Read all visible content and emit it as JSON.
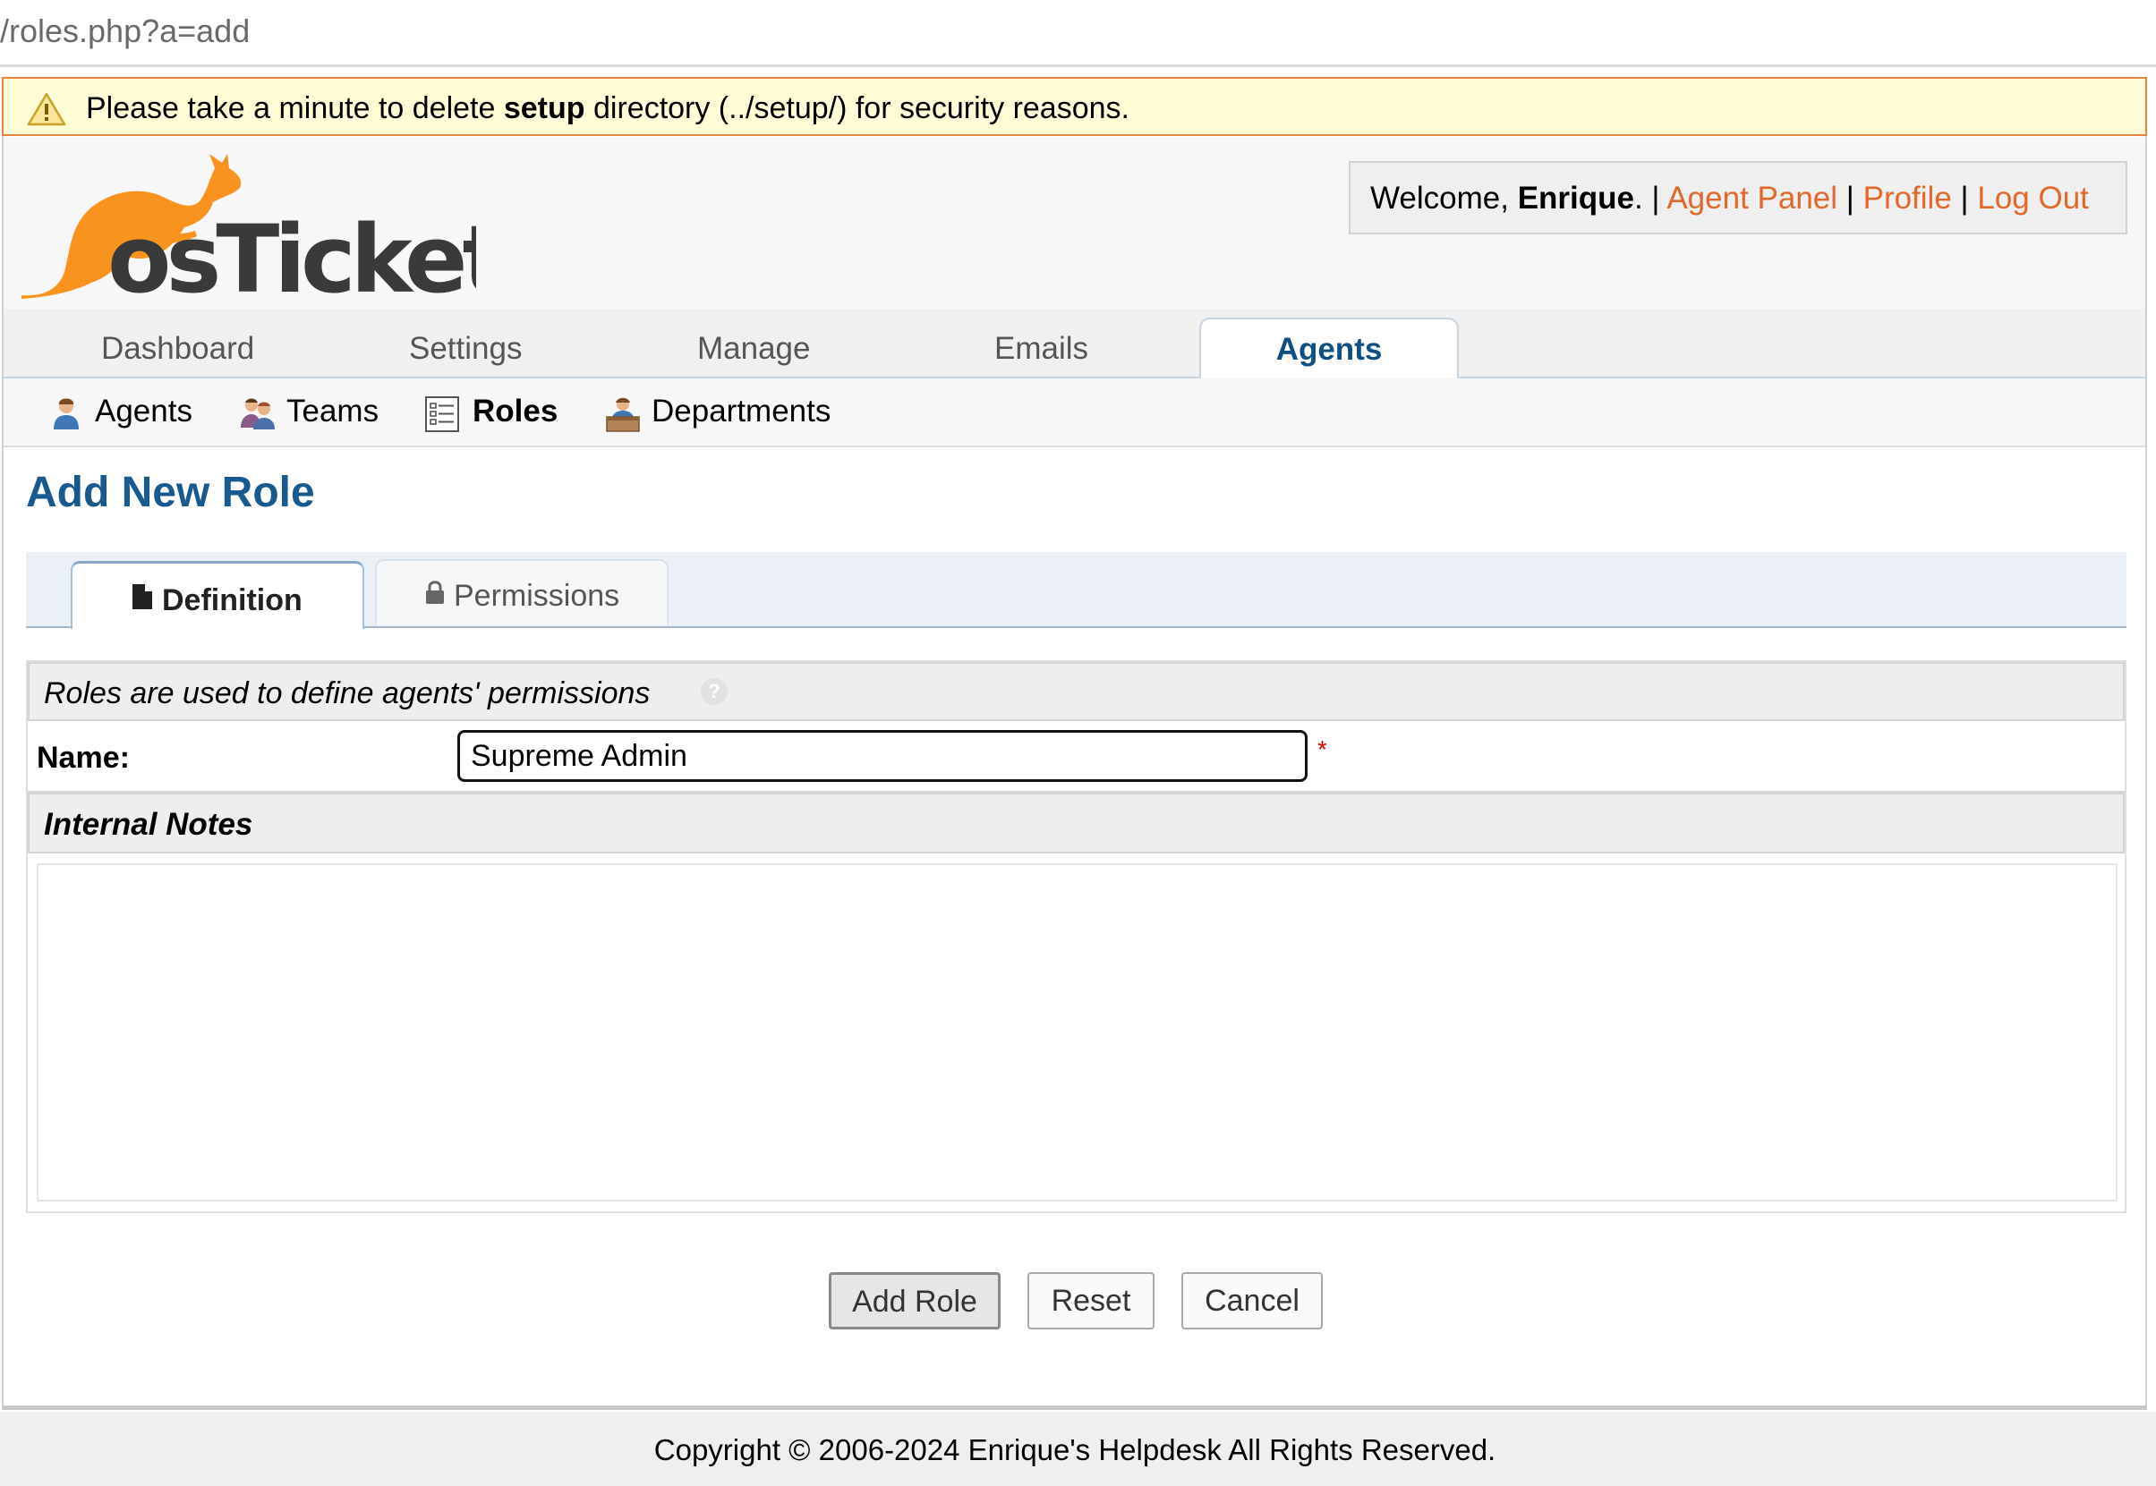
{
  "browser": {
    "url": "/roles.php?a=add"
  },
  "warning": {
    "pre": "Please take a minute to delete ",
    "bold": "setup",
    "post": " directory (../setup/) for security reasons."
  },
  "logo": {
    "text": "osTicket"
  },
  "welcome": {
    "prefix": "Welcome, ",
    "user": "Enrique",
    "suffix": ". | ",
    "agent_panel": "Agent Panel",
    "sep": " | ",
    "profile": "Profile",
    "logout": "Log Out"
  },
  "nav": {
    "items": [
      "Dashboard",
      "Settings",
      "Manage",
      "Emails",
      "Agents"
    ],
    "active": "Agents"
  },
  "subnav": {
    "items": [
      "Agents",
      "Teams",
      "Roles",
      "Departments"
    ],
    "active": "Roles"
  },
  "page": {
    "title": "Add New Role"
  },
  "tabs": {
    "definition": "Definition",
    "permissions": "Permissions"
  },
  "form": {
    "roles_header": "Roles are used to define agents' permissions",
    "help_icon": "?",
    "name_label": "Name:",
    "name_value": "Supreme Admin",
    "required_marker": "*",
    "notes_header": "Internal Notes",
    "notes_value": ""
  },
  "buttons": {
    "add": "Add Role",
    "reset": "Reset",
    "cancel": "Cancel"
  },
  "footer": {
    "copyright": "Copyright © 2006-2024 Enrique's Helpdesk All Rights Reserved."
  },
  "colors": {
    "link": "#e4672a",
    "title": "#185a8f",
    "warning_bg": "#fffcd6",
    "warning_border": "#e9843f"
  }
}
